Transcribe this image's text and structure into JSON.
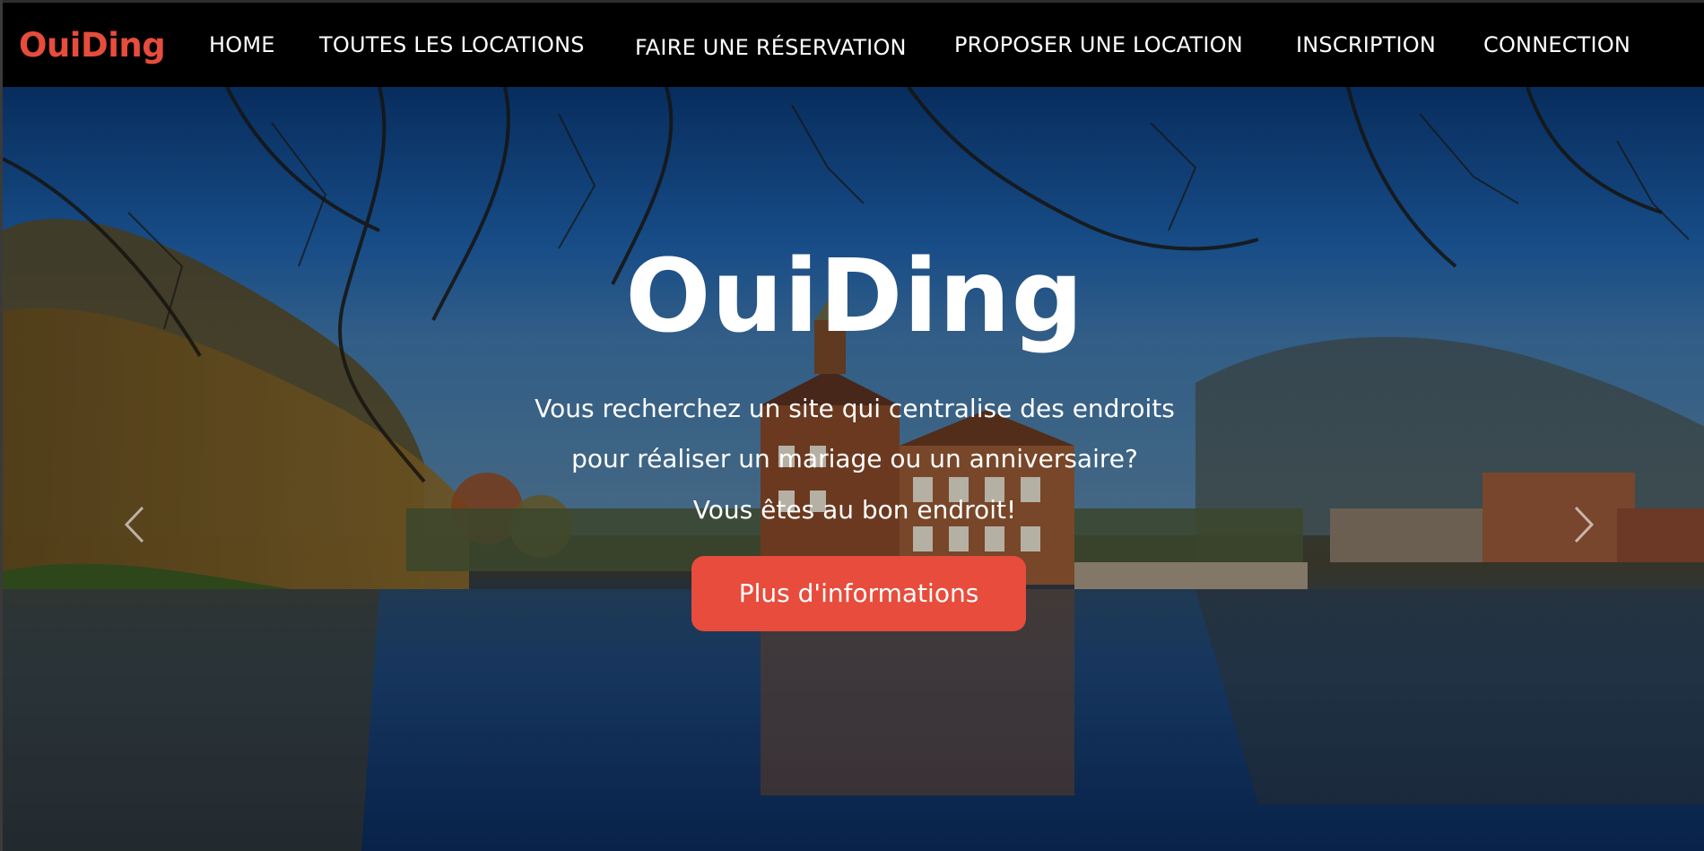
{
  "navbar": {
    "brand": "OuiDing",
    "links": [
      {
        "label": "HOME"
      },
      {
        "label": "TOUTES LES LOCATIONS"
      },
      {
        "label": "FAIRE UNE RÉSERVATION"
      },
      {
        "label": "PROPOSER UNE LOCATION"
      },
      {
        "label": "INSCRIPTION"
      },
      {
        "label": "CONNECTION"
      }
    ]
  },
  "hero": {
    "title": "OuiDing",
    "lines": [
      "Vous recherchez un site qui centralise des endroits",
      "pour réaliser un mariage ou un anniversaire?",
      "Vous êtes au bon endroit!"
    ],
    "cta_label": "Plus d'informations",
    "prev_icon": "chevron-left-icon",
    "next_icon": "chevron-right-icon"
  },
  "colors": {
    "accent": "#e74c3c",
    "navbar_bg": "#000000",
    "text": "#ffffff"
  }
}
